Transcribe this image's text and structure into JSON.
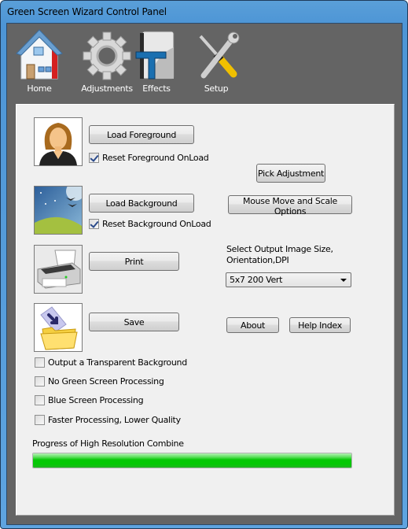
{
  "window": {
    "title": "Green Screen Wizard Control Panel"
  },
  "toolbar": {
    "items": [
      {
        "label": "Home",
        "icon": "home-icon"
      },
      {
        "label": "Adjustments",
        "icon": "gear-icon"
      },
      {
        "label": "Effects",
        "icon": "text-effects-icon"
      },
      {
        "label": "Setup",
        "icon": "tools-icon"
      }
    ]
  },
  "panel": {
    "load_foreground": "Load Foreground",
    "reset_foreground": {
      "label": "Reset Foreground OnLoad",
      "checked": true
    },
    "load_background": "Load Background",
    "reset_background": {
      "label": "Reset Background OnLoad",
      "checked": true
    },
    "print": "Print",
    "save": "Save",
    "pick_adjustment": "Pick Adjustment",
    "mouse_move": "Mouse Move and Scale Options",
    "output_size_label_line1": "Select Output Image Size,",
    "output_size_label_line2": "Orientation,DPI",
    "output_size_value": "5x7 200 Vert",
    "about": "About",
    "help_index": "Help Index",
    "options": [
      {
        "label": "Output a Transparent Background",
        "checked": false
      },
      {
        "label": "No Green Screen Processing",
        "checked": false
      },
      {
        "label": "Blue Screen Processing",
        "checked": false
      },
      {
        "label": "Faster Processing, Lower Quality",
        "checked": false
      }
    ],
    "progress_label": "Progress of High Resolution Combine",
    "progress_percent": 100
  },
  "colors": {
    "progress_fill": "#04c904",
    "frame": "#4d95d6",
    "client_bg": "#646464"
  }
}
